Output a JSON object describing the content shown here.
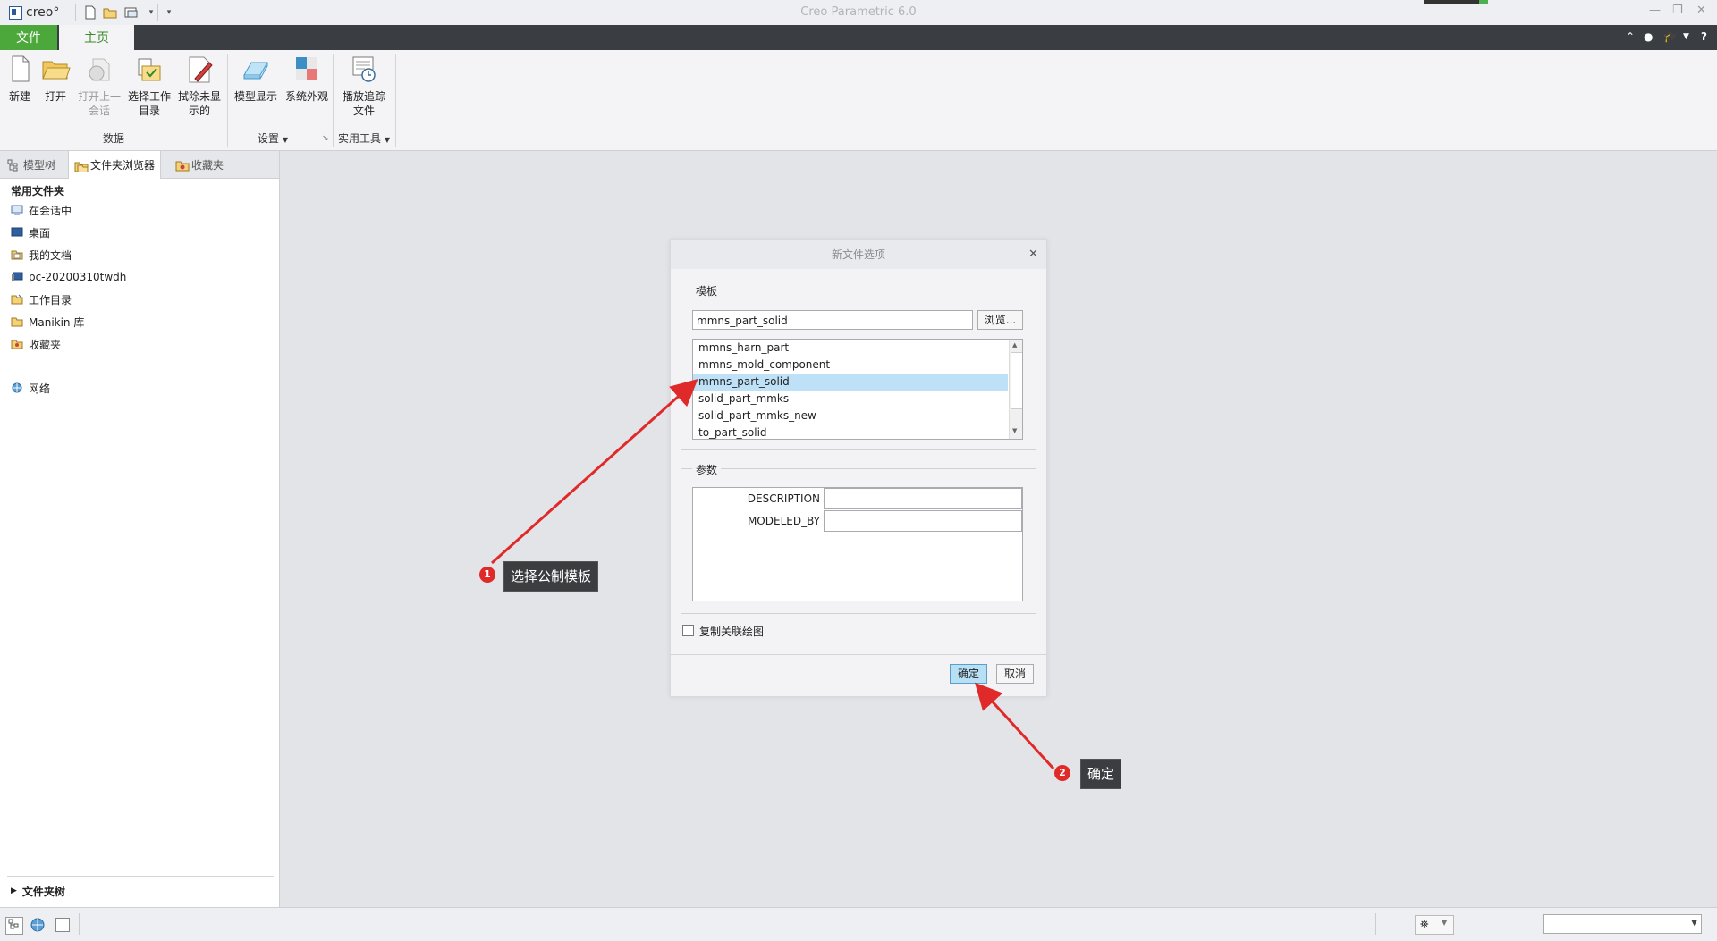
{
  "app": {
    "title": "Creo Parametric 6.0",
    "logo_text": "creo°"
  },
  "quick_access": {
    "icons": [
      "new-file-icon",
      "open-folder-icon",
      "window-icon",
      "customize-dropdown-icon"
    ]
  },
  "tabs": {
    "file": "文件",
    "home": "主页"
  },
  "ribbon": {
    "buttons": {
      "new": "新建",
      "open": "打开",
      "open_last_session": "打开上一会话",
      "select_working_dir": "选择工作目录",
      "erase_not_displayed": "拭除未显示的",
      "model_display": "模型显示",
      "system_appearance": "系统外观",
      "play_trail_file": "播放追踪文件"
    },
    "groups": {
      "data": "数据",
      "settings": "设置",
      "utilities": "实用工具"
    }
  },
  "navigator": {
    "tabs": {
      "model_tree": "模型树",
      "folder_browser": "文件夹浏览器",
      "favorites": "收藏夹"
    },
    "section_title": "常用文件夹",
    "items": [
      {
        "label": "在会话中",
        "icon": "session-icon"
      },
      {
        "label": "桌面",
        "icon": "desktop-icon"
      },
      {
        "label": "我的文档",
        "icon": "documents-icon"
      },
      {
        "label": "pc-20200310twdh",
        "icon": "computer-icon"
      },
      {
        "label": "工作目录",
        "icon": "working-folder-icon"
      },
      {
        "label": "Manikin 库",
        "icon": "library-folder-icon"
      },
      {
        "label": "收藏夹",
        "icon": "favorites-icon"
      }
    ],
    "network": "网络",
    "folder_tree": "文件夹树"
  },
  "dialog": {
    "title": "新文件选项",
    "template_legend": "模板",
    "template_value": "mmns_part_solid",
    "browse_label": "浏览...",
    "templates": [
      "mmns_harn_part",
      "mmns_mold_component",
      "mmns_part_solid",
      "solid_part_mmks",
      "solid_part_mmks_new",
      "to_part_solid"
    ],
    "selected_template": "mmns_part_solid",
    "params_legend": "参数",
    "params": [
      {
        "name": "DESCRIPTION",
        "value": ""
      },
      {
        "name": "MODELED_BY",
        "value": ""
      }
    ],
    "copy_drawings_label": "复制关联绘图",
    "ok_label": "确定",
    "cancel_label": "取消"
  },
  "annotations": [
    {
      "num": "1",
      "text": "选择公制模板"
    },
    {
      "num": "2",
      "text": "确定"
    }
  ],
  "colors": {
    "file_tab": "#4ca83a",
    "home_tab_text": "#3a8a2a",
    "selection": "#bfe1f7",
    "primary_button": "#b7e0f5",
    "arrow": "#e02a2a",
    "callout_bg": "#3b3d40"
  }
}
